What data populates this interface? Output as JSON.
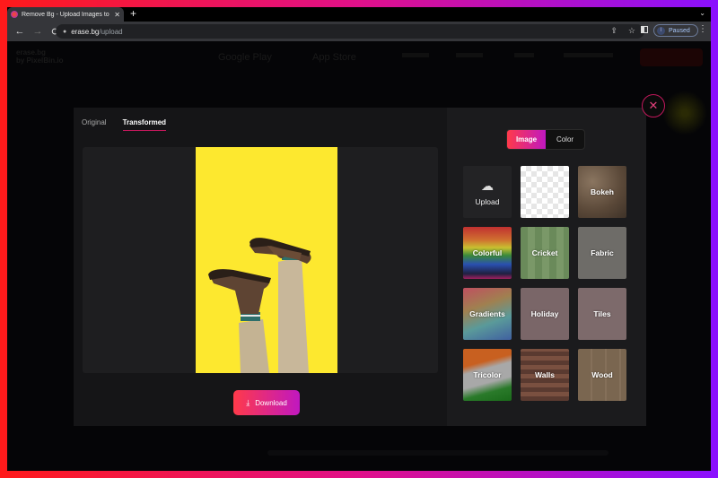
{
  "browser": {
    "tab_title": "Remove Bg - Upload Images to",
    "tab_close": "✕",
    "new_tab": "+",
    "tab_dropdown": "⌄",
    "back": "←",
    "forward": "→",
    "reload": "⟳",
    "lock": "🔒",
    "url_host": "erase.bg",
    "url_path": "/upload",
    "share": "⇪",
    "bookmark": "☆",
    "profile_initial": "I",
    "profile_status": "Paused",
    "menu": "⋮"
  },
  "background_page": {
    "logo_line1": "erase.bg",
    "logo_line2": "by PixelBin.io",
    "google_play": "Google Play",
    "app_store": "App Store"
  },
  "modal": {
    "tabs": [
      {
        "label": "Original",
        "active": false
      },
      {
        "label": "Transformed",
        "active": true
      }
    ],
    "download_label": "Download",
    "download_icon": "⤓",
    "close_icon": "✕",
    "segment": [
      {
        "label": "Image",
        "active": true
      },
      {
        "label": "Color",
        "active": false
      }
    ],
    "upload_label": "Upload",
    "upload_icon": "☁",
    "backgrounds": [
      {
        "label": "Bokeh",
        "color": "#6a5a48"
      },
      {
        "label": "Colorful",
        "color": "rainbow"
      },
      {
        "label": "Cricket",
        "color": "#7a8a5a"
      },
      {
        "label": "Fabric",
        "color": "#6e6c68"
      },
      {
        "label": "Gradients",
        "color": "gradient"
      },
      {
        "label": "Holiday",
        "color": "#7a6668"
      },
      {
        "label": "Tiles",
        "color": "#7d6a6b"
      },
      {
        "label": "Tricolor",
        "color": "tricolor"
      },
      {
        "label": "Walls",
        "color": "#6b4a40"
      },
      {
        "label": "Wood",
        "color": "#7a6650"
      }
    ]
  },
  "colors": {
    "accent_start": "#ff3a4a",
    "accent_end": "#c018c0",
    "preview_bg": "#fde82f"
  }
}
